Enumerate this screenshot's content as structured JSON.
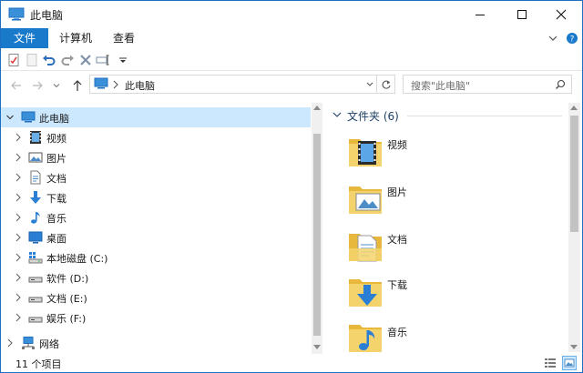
{
  "window": {
    "title": "此电脑"
  },
  "ribbon": {
    "tabs": [
      {
        "label": "文件"
      },
      {
        "label": "计算机"
      },
      {
        "label": "查看"
      }
    ]
  },
  "address": {
    "crumb": "此电脑"
  },
  "search": {
    "placeholder": "搜索\"此电脑\""
  },
  "tree": {
    "root": "此电脑",
    "items": [
      {
        "label": "视频",
        "icon": "video-folder-icon"
      },
      {
        "label": "图片",
        "icon": "pictures-folder-icon"
      },
      {
        "label": "文档",
        "icon": "documents-folder-icon"
      },
      {
        "label": "下载",
        "icon": "downloads-folder-icon"
      },
      {
        "label": "音乐",
        "icon": "music-folder-icon"
      },
      {
        "label": "桌面",
        "icon": "desktop-folder-icon"
      },
      {
        "label": "本地磁盘 (C:)",
        "icon": "system-drive-icon"
      },
      {
        "label": "软件 (D:)",
        "icon": "drive-icon"
      },
      {
        "label": "文档 (E:)",
        "icon": "drive-icon"
      },
      {
        "label": "娱乐 (F:)",
        "icon": "drive-icon"
      }
    ],
    "network": "网络"
  },
  "content": {
    "group_title": "文件夹 (6)",
    "folders": [
      {
        "label": "视频",
        "overlay": "video"
      },
      {
        "label": "图片",
        "overlay": "picture"
      },
      {
        "label": "文档",
        "overlay": "document"
      },
      {
        "label": "下载",
        "overlay": "download"
      },
      {
        "label": "音乐",
        "overlay": "music"
      }
    ]
  },
  "status": {
    "count": "11 个项目"
  },
  "colors": {
    "accent": "#1979ca",
    "selection": "#cce8ff",
    "folder": "#f5d36c",
    "folder_dark": "#e8b83c"
  }
}
